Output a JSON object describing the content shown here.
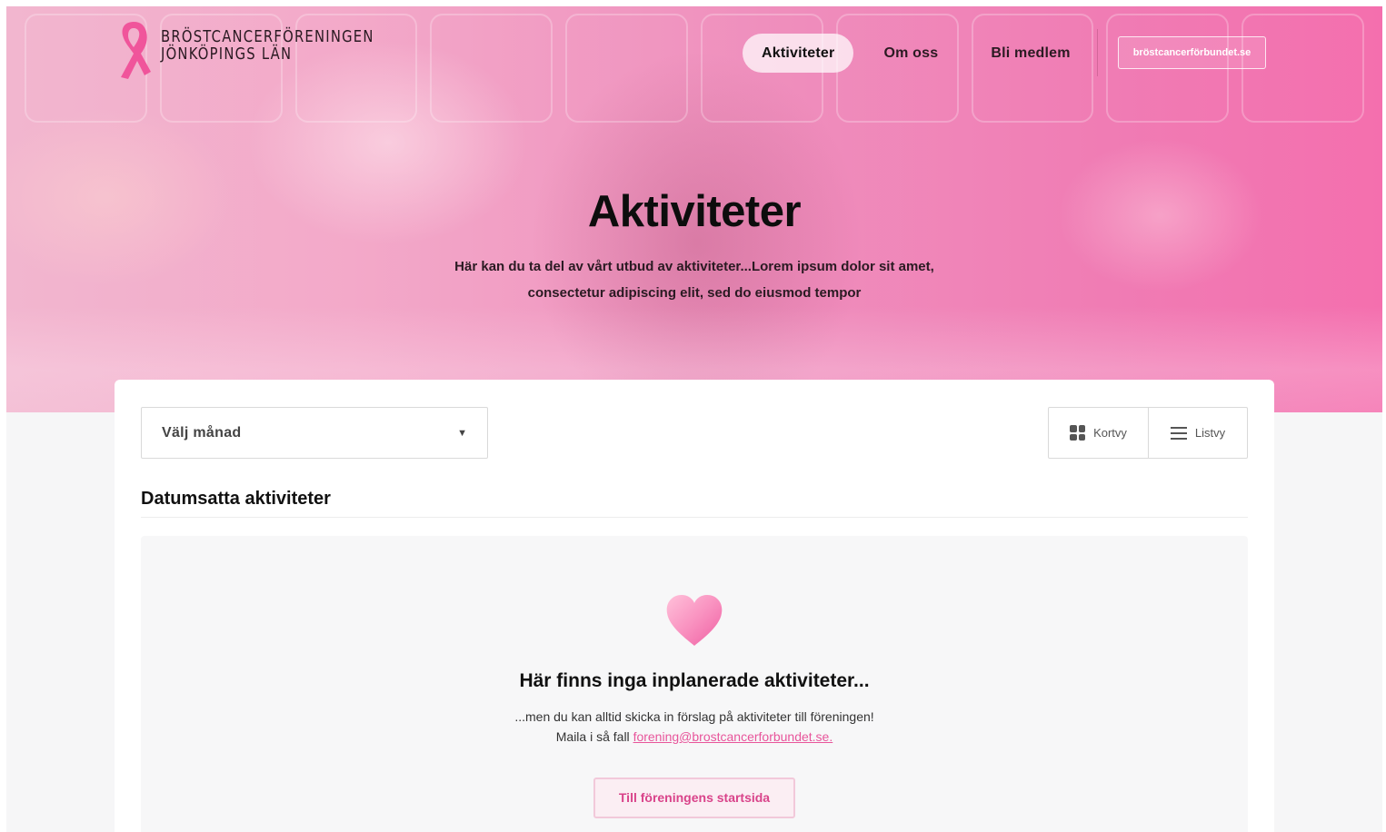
{
  "logo": {
    "line1": "BRÖSTCANCERFÖRENINGEN",
    "line2": "JÖNKÖPINGS LÄN",
    "ribbon_color": "#f0559b"
  },
  "nav": {
    "items": [
      {
        "label": "Aktiviteter",
        "active": true
      },
      {
        "label": "Om oss",
        "active": false
      },
      {
        "label": "Bli medlem",
        "active": false
      }
    ],
    "site_button": "bröstcancerförbundet.se"
  },
  "hero": {
    "title": "Aktiviteter",
    "subtitle_line1": "Här kan du ta del av vårt utbud av aktiviteter...Lorem ipsum dolor sit amet,",
    "subtitle_line2": "consectetur adipiscing elit, sed do eiusmod tempor"
  },
  "filters": {
    "month_select": {
      "value": "Välj månad",
      "icon": "caret-down-icon"
    },
    "views": [
      {
        "label": "Kortvy",
        "icon": "grid-icon"
      },
      {
        "label": "Listvy",
        "icon": "list-icon"
      }
    ]
  },
  "section": {
    "title": "Datumsatta aktiviteter"
  },
  "empty_state": {
    "icon": "heart-icon",
    "title": "Här finns inga inplanerade aktiviteter...",
    "text_line1": "...men du kan alltid skicka in förslag på aktiviteter till föreningen!",
    "text_line2_prefix": "Maila i så fall",
    "email": "forening@brostcancerforbundet.se.",
    "button": "Till föreningens startsida"
  },
  "colors": {
    "accent": "#e8559b",
    "hero_pink": "#f07cb4",
    "button_bg": "#fbeef3"
  }
}
